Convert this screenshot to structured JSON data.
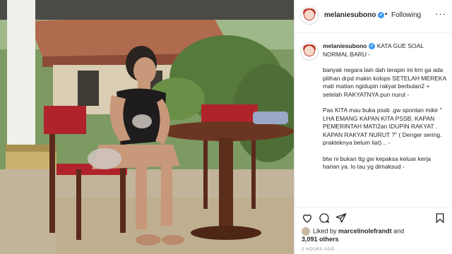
{
  "header": {
    "username": "melaniesubono",
    "follow_status": "Following",
    "separator": "•"
  },
  "caption": {
    "username": "melaniesubono",
    "title": "KATA GUE SOAL NORMAL BARU -",
    "paragraphs": [
      "banyak negara lain dah terapin ini krn ga ada pilihan drpd makin kolops SETELAH MEREKA mati matian ngidupin rakyat berbulan2 + setelah RAKYATNYA pun nurut -",
      "Pas KITA mau buka pssb .gw spontan mikir \" LHA EMANG KAPAN KITA PSSB. KAPAN PEMERINTAH MATI2an IDUPIN RAKYAT . KAPAN RAKYAT NURUT ?\" ( Denger sering. prakteknya belum liat) .. -",
      "btw ni bukan ttg gw kepaksa keluar kerja harian ya. lo tau yg dimaksud -"
    ]
  },
  "likes": {
    "prefix": "Liked by",
    "user": "marcelinolefrandt",
    "connector": "and",
    "others": "3,091 others"
  },
  "timestamp": "2 HOURS AGO",
  "icons": [
    "heart-icon",
    "comment-icon",
    "share-icon",
    "bookmark-icon",
    "verified-icon",
    "more-icon"
  ],
  "colors": {
    "verified": "#3897f0",
    "text": "#262626",
    "muted": "#8e8e8e",
    "border": "#dbdbdb"
  }
}
